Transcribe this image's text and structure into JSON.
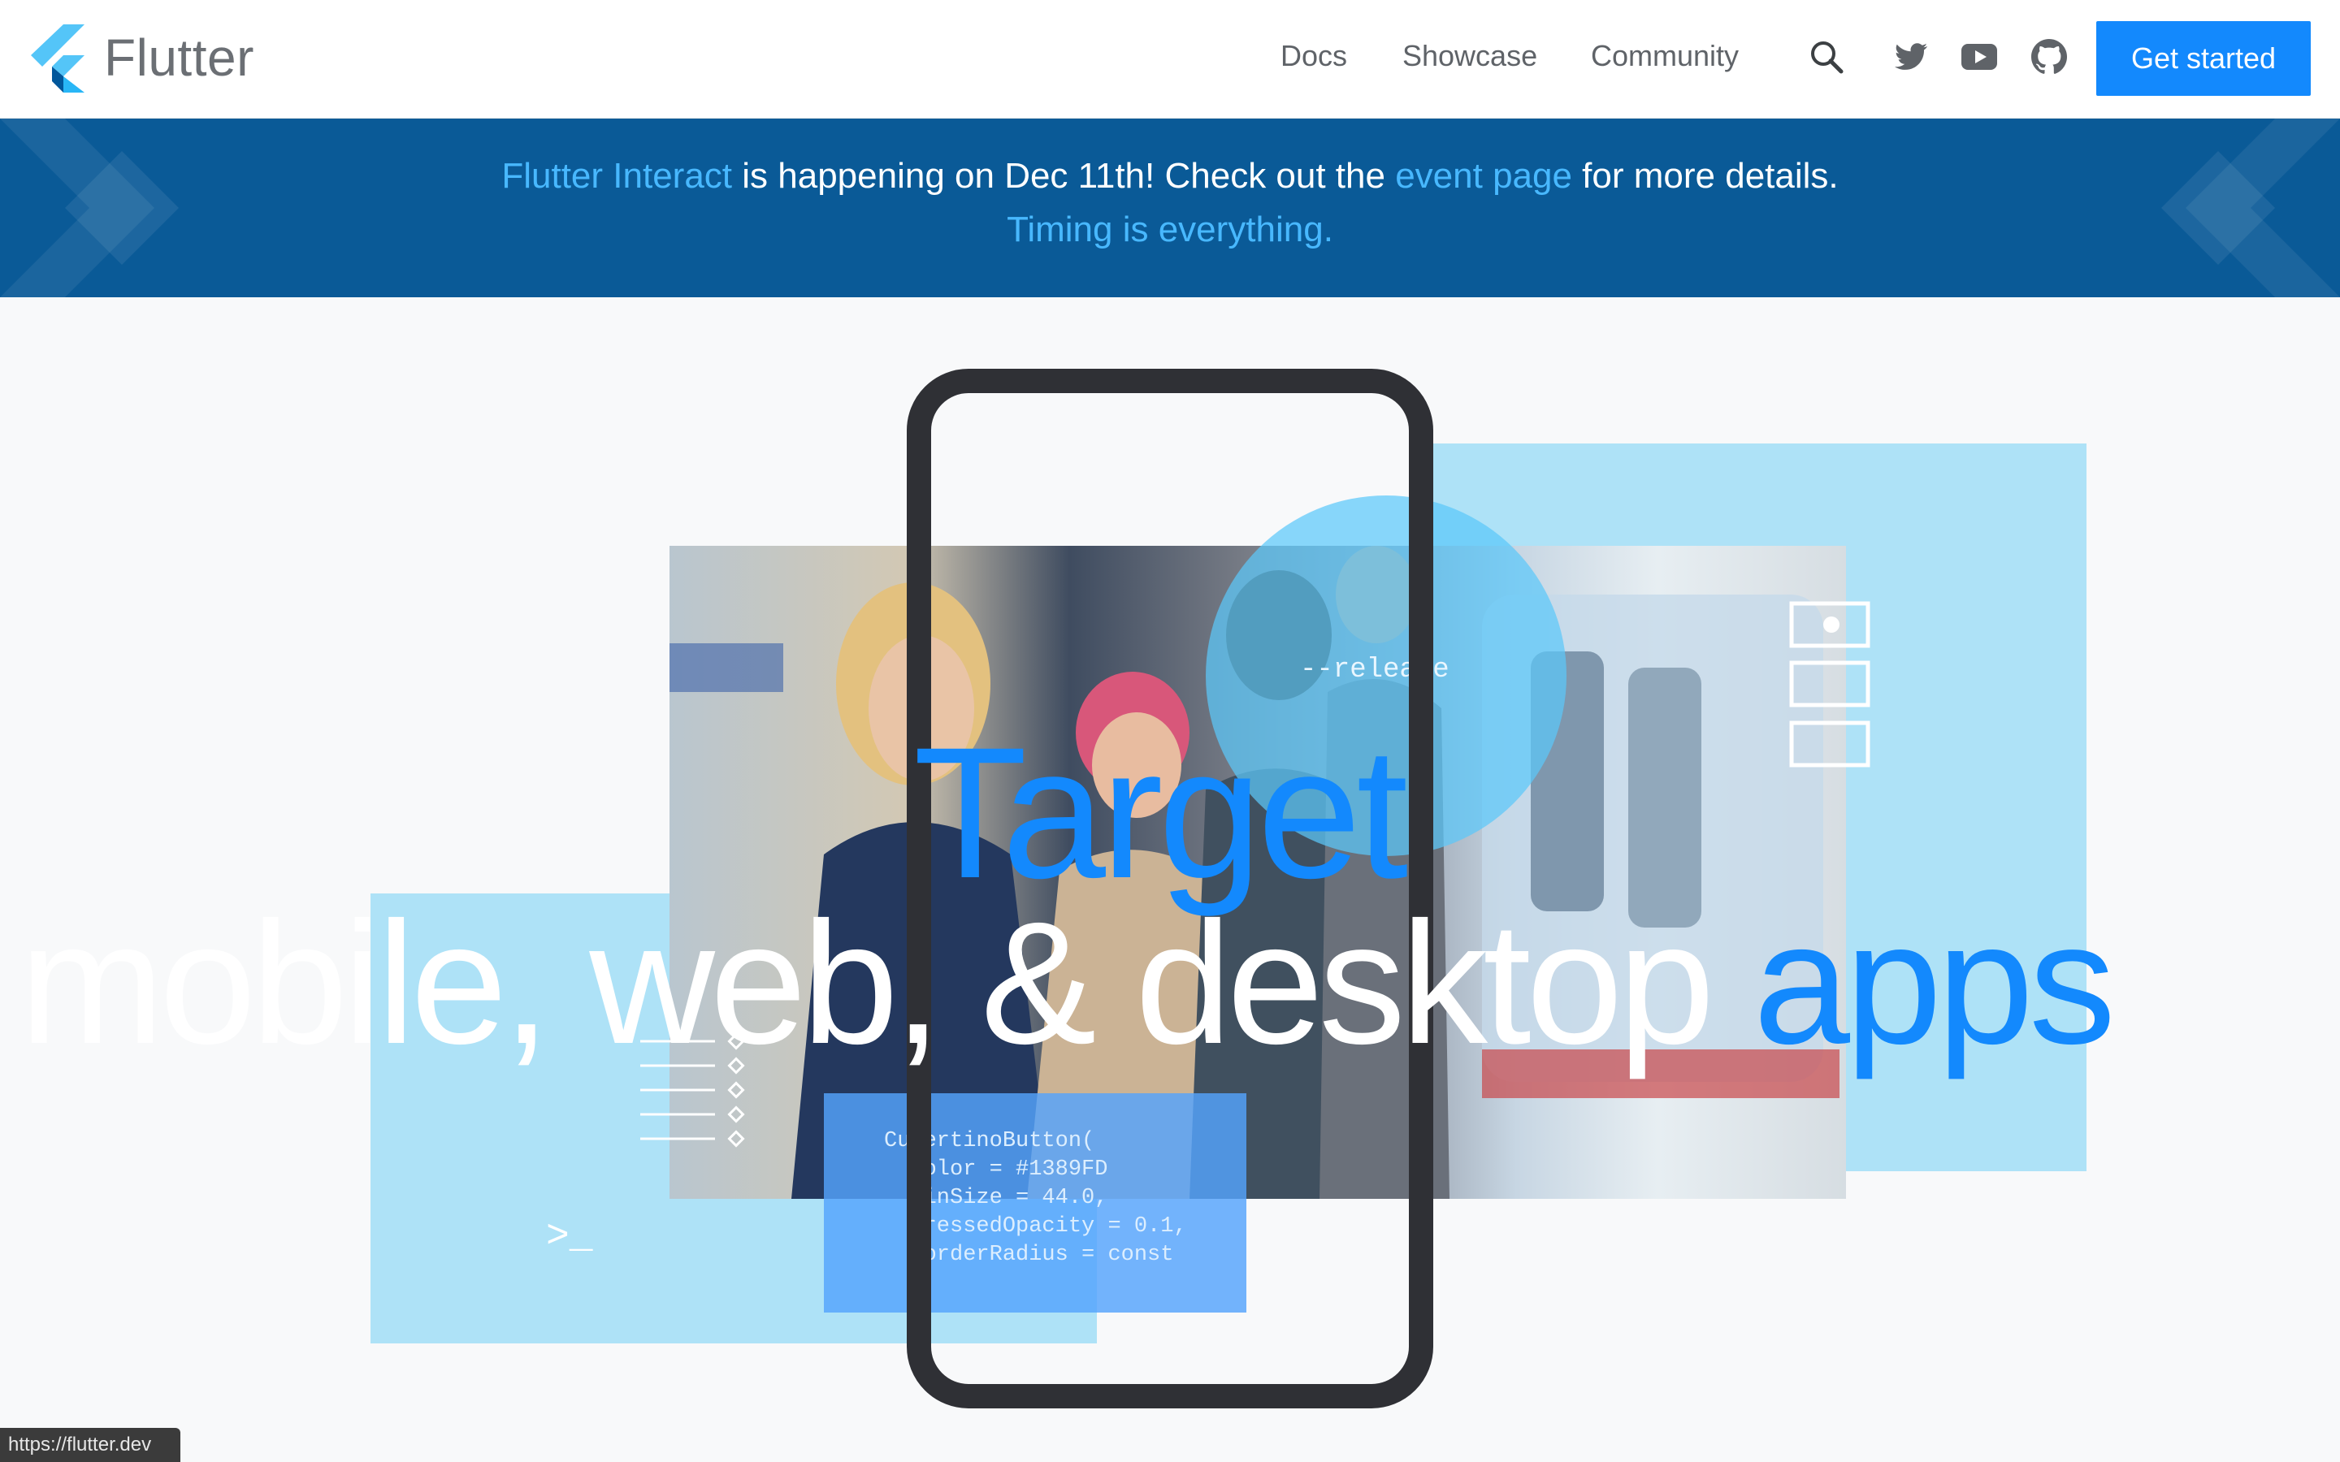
{
  "header": {
    "brand": "Flutter",
    "nav": [
      {
        "label": "Docs"
      },
      {
        "label": "Showcase"
      },
      {
        "label": "Community"
      }
    ],
    "icons": [
      "search-icon",
      "twitter-icon",
      "youtube-icon",
      "github-icon"
    ],
    "cta_label": "Get started"
  },
  "banner": {
    "link_interact": "Flutter Interact",
    "text_mid": " is happening on Dec 11th! Check out the ",
    "link_event": "event page",
    "text_end": " for more details.",
    "link_timing": "Timing is everything."
  },
  "hero": {
    "target": "Target",
    "main_white": "mobile, web, & desktop ",
    "main_blue": "apps",
    "release_text": "--release",
    "terminal_prompt": ">_",
    "code_lines": [
      "CupertinoButton(",
      "  color = #1389FD",
      "  minSize = 44.0,",
      "  pressedOpacity = 0.1,",
      "  borderRadius = const"
    ]
  },
  "status_bar": {
    "url": "https://flutter.dev"
  },
  "colors": {
    "brand_blue": "#1389fd",
    "banner_bg": "#0a5a97",
    "link_blue": "#48b8ff",
    "light_blue_block": "#aee2f7"
  }
}
